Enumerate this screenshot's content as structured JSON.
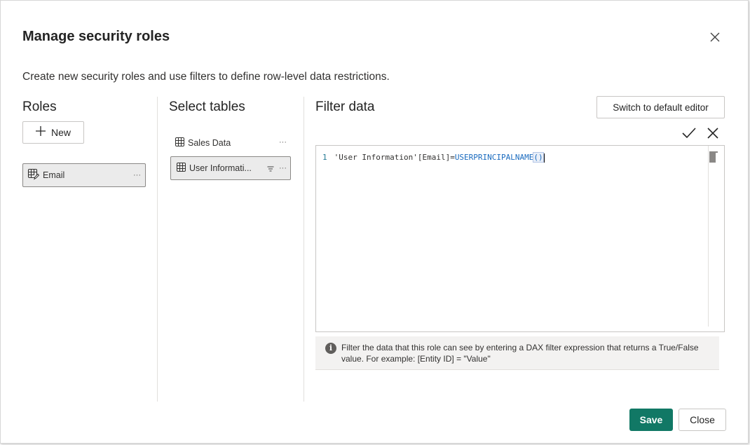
{
  "dialog": {
    "title": "Manage security roles",
    "subtitle": "Create new security roles and use filters to define row-level data restrictions."
  },
  "roles": {
    "heading": "Roles",
    "new_label": "New",
    "items": [
      {
        "label": "Email",
        "more": "···"
      }
    ]
  },
  "tables": {
    "heading": "Select tables",
    "items": [
      {
        "label": "Sales Data",
        "more": "···"
      },
      {
        "label": "User Informati...",
        "more": "···"
      }
    ]
  },
  "filter": {
    "heading": "Filter data",
    "switch_label": "Switch to default editor",
    "code": {
      "line_number": "1",
      "text_part": "'User Information'[Email]=",
      "function_part": "USERPRINCIPALNAME",
      "parens": "()"
    },
    "info_text": "Filter the data that this role can see by entering a DAX filter expression that returns a True/False value. For example: [Entity ID] = \"Value\""
  },
  "footer": {
    "save_label": "Save",
    "close_label": "Close"
  },
  "colors": {
    "primary": "#117865",
    "selected_bg": "#ebebeb",
    "info_bg": "#f3f2f1"
  },
  "icons": [
    "close-icon",
    "plus-icon",
    "table-edit-icon",
    "table-icon",
    "filter-icon",
    "checkmark-icon",
    "cancel-icon",
    "info-icon"
  ]
}
